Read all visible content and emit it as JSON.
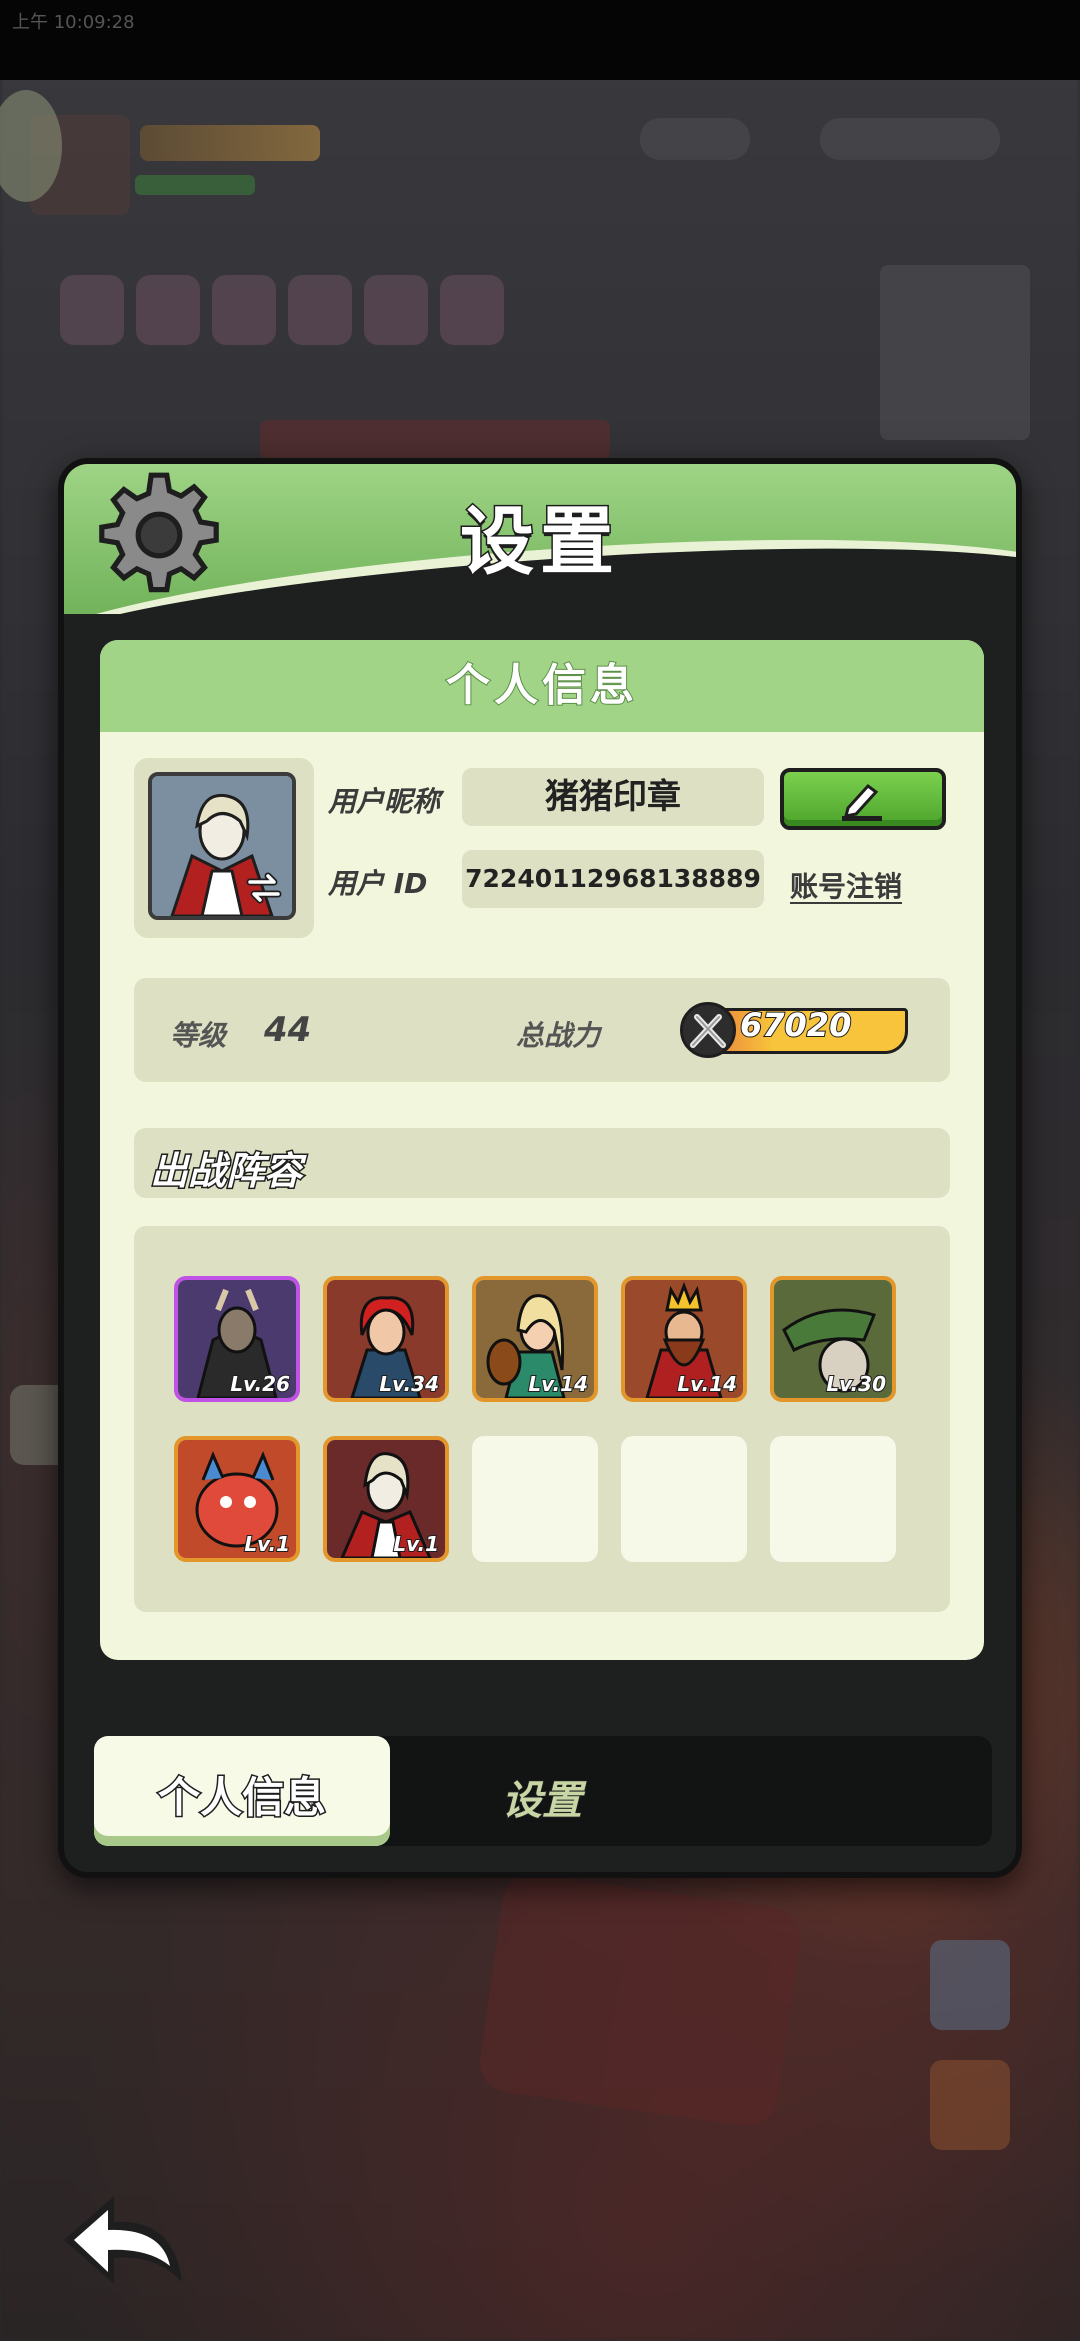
{
  "status_bar": {
    "time": "上午 10:09:28"
  },
  "dialog": {
    "title": "设置",
    "section_title": "个人信息",
    "profile": {
      "nickname_label": "用户昵称",
      "nickname": "猪猪印章",
      "id_label": "用户  ID",
      "user_id": "72240112968138889",
      "cancel_account": "账号注销"
    },
    "stats": {
      "level_label": "等级",
      "level": "44",
      "power_label": "总战力",
      "power": "67020"
    },
    "lineup": {
      "title": "出战阵容",
      "heroes": [
        {
          "level": "Lv.26",
          "rarity": "purple",
          "color": "#4b3a6e"
        },
        {
          "level": "Lv.34",
          "rarity": "orange",
          "color": "#8a3a2a"
        },
        {
          "level": "Lv.14",
          "rarity": "orange",
          "color": "#8a6a3a"
        },
        {
          "level": "Lv.14",
          "rarity": "orange",
          "color": "#9a4a2a"
        },
        {
          "level": "Lv.30",
          "rarity": "orange",
          "color": "#5a6a3a"
        },
        {
          "level": "Lv.1",
          "rarity": "orange",
          "color": "#c04a2a"
        },
        {
          "level": "Lv.1",
          "rarity": "orange",
          "color": "#6a2a2a"
        }
      ],
      "empty_slots": 3
    },
    "tabs": {
      "active": "个人信息",
      "other": "设置"
    }
  },
  "colors": {
    "header_green": "#9ed485",
    "panel_bg": "#f2f6dc",
    "edit_button": "#5cb83a",
    "power_bar": "#f7c43b"
  },
  "icons": [
    "gear-icon",
    "swap-icon",
    "edit-pencil-icon",
    "sword-icon",
    "back-arrow-icon"
  ]
}
